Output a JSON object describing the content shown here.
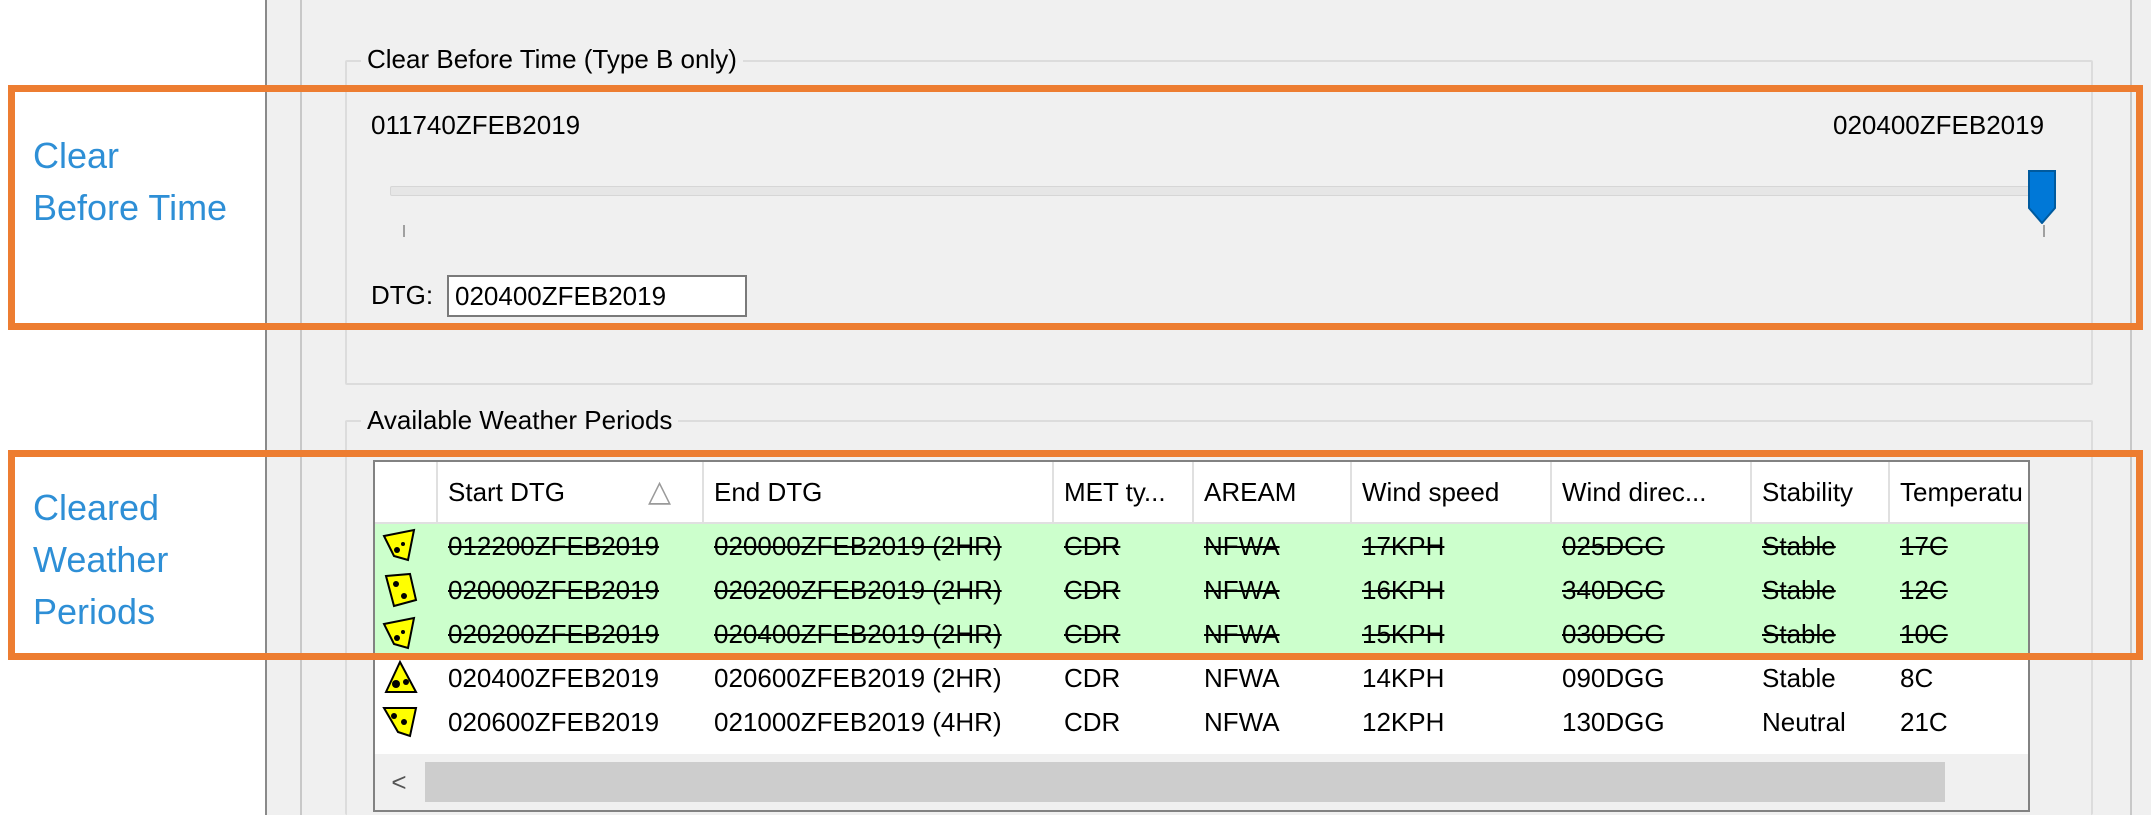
{
  "clear_before_time": {
    "group_title": "Clear Before Time (Type B only)",
    "slider_min_label": "011740ZFEB2019",
    "slider_max_label": "020400ZFEB2019",
    "slider_position": 1.0,
    "dtg_label": "DTG:",
    "dtg_value": "020400ZFEB2019"
  },
  "weather_periods": {
    "group_title": "Available Weather Periods",
    "columns": [
      "",
      "Start DTG",
      "End DTG",
      "MET ty...",
      "AREAM",
      "Wind speed",
      "Wind direc...",
      "Stability",
      "Temperatu"
    ],
    "sort_indicator": "△",
    "rows": [
      {
        "icon": "weather-symbol-icon",
        "start": "012200ZFEB2019",
        "end": "020000ZFEB2019 (2HR)",
        "met": "CDR",
        "aream": "NFWA",
        "wind_speed": "17KPH",
        "wind_dir": "025DGG",
        "stability": "Stable",
        "temp": "17C",
        "cleared": true
      },
      {
        "icon": "weather-symbol-icon",
        "start": "020000ZFEB2019",
        "end": "020200ZFEB2019 (2HR)",
        "met": "CDR",
        "aream": "NFWA",
        "wind_speed": "16KPH",
        "wind_dir": "340DGG",
        "stability": "Stable",
        "temp": "12C",
        "cleared": true
      },
      {
        "icon": "weather-symbol-icon",
        "start": "020200ZFEB2019",
        "end": "020400ZFEB2019 (2HR)",
        "met": "CDR",
        "aream": "NFWA",
        "wind_speed": "15KPH",
        "wind_dir": "030DGG",
        "stability": "Stable",
        "temp": "10C",
        "cleared": true
      },
      {
        "icon": "weather-symbol-icon",
        "start": "020400ZFEB2019",
        "end": "020600ZFEB2019 (2HR)",
        "met": "CDR",
        "aream": "NFWA",
        "wind_speed": "14KPH",
        "wind_dir": "090DGG",
        "stability": "Stable",
        "temp": "8C",
        "cleared": false
      },
      {
        "icon": "weather-symbol-icon",
        "start": "020600ZFEB2019",
        "end": "021000ZFEB2019 (4HR)",
        "met": "CDR",
        "aream": "NFWA",
        "wind_speed": "12KPH",
        "wind_dir": "130DGG",
        "stability": "Neutral",
        "temp": "21C",
        "cleared": false
      }
    ],
    "scroll_up": "^",
    "scroll_down": "⌄",
    "scroll_left": "<",
    "scroll_right": ">"
  },
  "annotations": {
    "clear_before_time_label": "Clear Before Time",
    "cleared_weather_label": "Cleared Weather Periods",
    "accent_color": "#ed7d31",
    "label_color": "#2e8fd6",
    "cleared_row_color": "#ccffcc"
  }
}
